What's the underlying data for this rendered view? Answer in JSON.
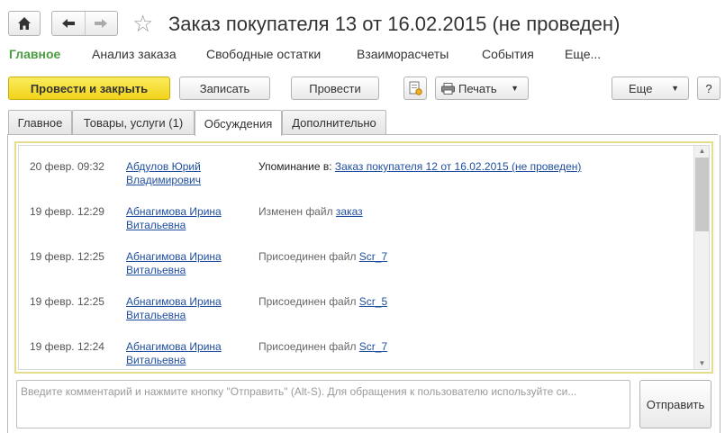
{
  "header": {
    "title": "Заказ покупателя 13 от 16.02.2015 (не проведен)"
  },
  "nav": {
    "items": [
      {
        "label": "Главное",
        "active": true
      },
      {
        "label": "Анализ заказа",
        "active": false
      },
      {
        "label": "Свободные остатки",
        "active": false
      },
      {
        "label": "Взаиморасчеты",
        "active": false
      },
      {
        "label": "События",
        "active": false
      },
      {
        "label": "Еще...",
        "active": false
      }
    ]
  },
  "toolbar": {
    "post_and_close": "Провести и закрыть",
    "save": "Записать",
    "post": "Провести",
    "print": "Печать",
    "more": "Еще",
    "help": "?"
  },
  "tabs": [
    {
      "label": "Главное",
      "active": false
    },
    {
      "label": "Товары, услуги (1)",
      "active": false
    },
    {
      "label": "Обсуждения",
      "active": true
    },
    {
      "label": "Дополнительно",
      "active": false
    }
  ],
  "discussion": {
    "entries": [
      {
        "time": "20 февр. 09:32",
        "author": "Абдулов Юрий Владимирович",
        "action_prefix": "Упоминание в: ",
        "link": "Заказ покупателя 12 от 16.02.2015 (не проведен)",
        "dark": true
      },
      {
        "time": "19 февр. 12:29",
        "author": "Абнагимова Ирина Витальевна",
        "action_prefix": "Изменен файл ",
        "link": "заказ",
        "dark": false
      },
      {
        "time": "19 февр. 12:25",
        "author": "Абнагимова Ирина Витальевна",
        "action_prefix": "Присоединен файл ",
        "link": "Scr_7",
        "dark": false
      },
      {
        "time": "19 февр. 12:25",
        "author": "Абнагимова Ирина Витальевна",
        "action_prefix": "Присоединен файл ",
        "link": "Scr_5",
        "dark": false
      },
      {
        "time": "19 февр. 12:24",
        "author": "Абнагимова Ирина Витальевна",
        "action_prefix": "Присоединен файл ",
        "link": "Scr_7",
        "dark": false
      }
    ]
  },
  "comment": {
    "placeholder": "Введите комментарий и нажмите кнопку \"Отправить\" (Alt-S). Для обращения к пользователю используйте си...",
    "value": "",
    "send": "Отправить"
  },
  "colors": {
    "accent_green": "#4a9d40",
    "primary_yellow": "#f2d31b",
    "link_blue": "#1f4e9e",
    "focus_border": "#e5dc8e"
  },
  "icons": [
    "home-icon",
    "back-arrow-icon",
    "forward-arrow-icon",
    "star-icon",
    "document-structure-icon",
    "printer-icon",
    "chevron-down-icon",
    "scroll-up-icon",
    "scroll-down-icon"
  ]
}
